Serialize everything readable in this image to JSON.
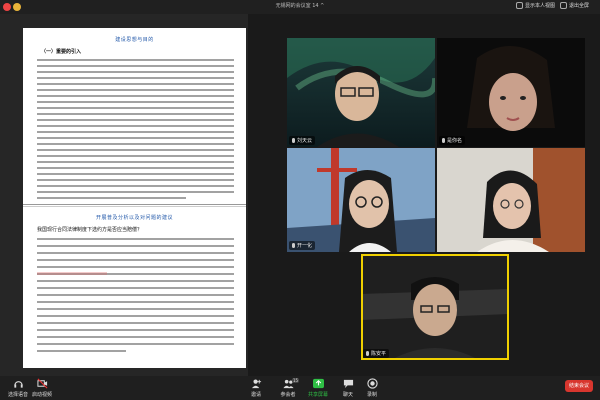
{
  "window": {
    "title": "无锡网的会议室  14 ^",
    "right_buttons": [
      {
        "label": "显示本人视图"
      },
      {
        "label": "退出全屏"
      }
    ]
  },
  "document": {
    "section_title_1": "建设思想与目的",
    "subsection_1": "（一）重要的引入",
    "section_title_2": "开展普及分析以及对问题的建议",
    "paragraph_2_intro": "我国现行合同法律制度下选约方是否应当赔偿？"
  },
  "participants": [
    {
      "name": "刘天云"
    },
    {
      "name": "是你名"
    },
    {
      "name": "开一化"
    },
    {
      "name": ""
    },
    {
      "name": "陈安平"
    }
  ],
  "toolbar": {
    "left": [
      {
        "label": "选择语音"
      },
      {
        "label": "启动视频"
      }
    ],
    "center": [
      {
        "label": "邀请"
      },
      {
        "label": "参会者",
        "badge": "15"
      },
      {
        "label": "共享屏幕"
      },
      {
        "label": "聊天"
      },
      {
        "label": "录制"
      }
    ],
    "end_button": {
      "label": "结束会议"
    }
  },
  "colors": {
    "share_green": "#2fbf45",
    "doc_heading_blue": "#1f56a8",
    "active_speaker": "#f0d000"
  }
}
